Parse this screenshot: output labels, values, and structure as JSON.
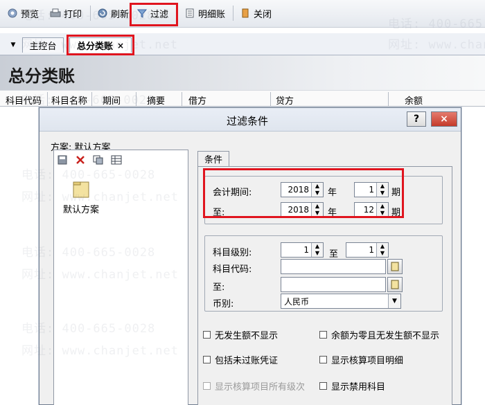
{
  "toolbar": {
    "preview": "预览",
    "print": "打印",
    "refresh": "刷新",
    "filter": "过滤",
    "detail": "明细账",
    "close": "关闭"
  },
  "tabs": {
    "home": "主控台",
    "ledger": "总分类账",
    "ledger_close": "×"
  },
  "banner": {
    "title": "总分类账"
  },
  "columns": [
    "科目代码",
    "科目名称",
    "期间",
    "摘要",
    "借方",
    "贷方",
    "余额"
  ],
  "dialog": {
    "title": "过滤条件",
    "help": "?",
    "close": "×",
    "scheme_label": "方案: 默认方案",
    "scheme_item": "默认方案",
    "tab_condition": "条件",
    "period_label": "会计期间:",
    "to_label": "至:",
    "year_unit": "年",
    "period_unit": "期",
    "from_year": "2018",
    "from_period": "1",
    "to_year": "2018",
    "to_period": "12",
    "level_label": "科目级别:",
    "level_from": "1",
    "level_to_label": "至",
    "level_to": "1",
    "code_label": "科目代码:",
    "code_value": "",
    "code_to_label": "至:",
    "code_to_value": "",
    "currency_label": "币别:",
    "currency_value": "人民币",
    "checks": {
      "c1": "无发生额不显示",
      "c2": "余额为零且无发生额不显示",
      "c3": "包括未过账凭证",
      "c4": "显示核算项目明细",
      "c5": "显示核算项目所有级次",
      "c6": "显示禁用科目"
    }
  },
  "watermark": {
    "phone": "电话: 400-665-0028",
    "site": "网址: www.chanjet.net"
  },
  "colors": {
    "highlight": "#e0141e",
    "close_button": "#c43a2a"
  }
}
